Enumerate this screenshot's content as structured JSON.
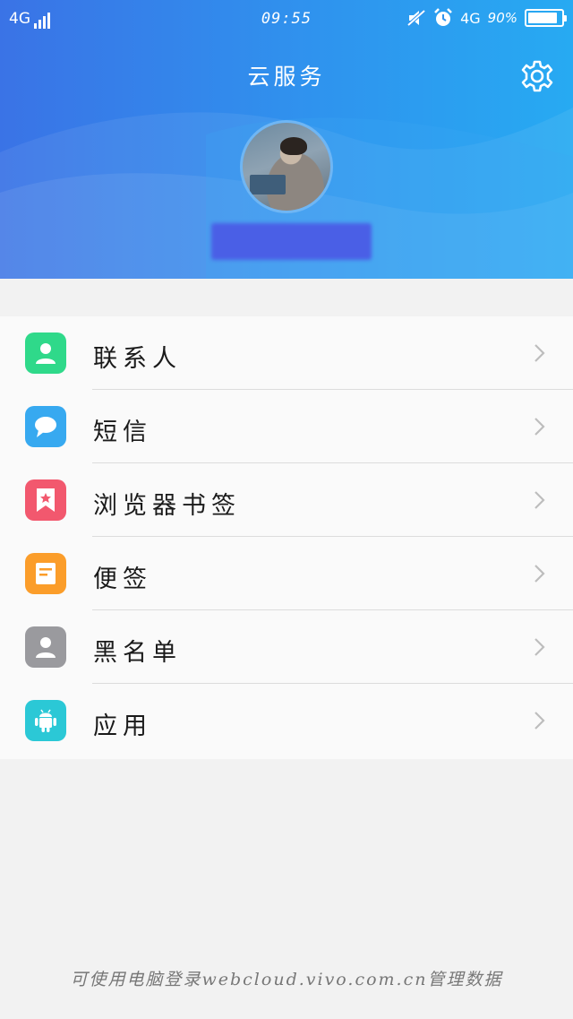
{
  "status_bar": {
    "network_left": "4G",
    "time": "09:55",
    "network_right": "4G",
    "battery_percent": "90%",
    "battery_level": 0.9,
    "icons": [
      "signal-bars-icon",
      "mute-icon",
      "alarm-icon",
      "battery-icon"
    ]
  },
  "header": {
    "title": "云服务",
    "settings_icon": "gear-icon",
    "avatar": "user-avatar-photo",
    "username_redacted": true
  },
  "menu": {
    "items": [
      {
        "label": "联系人",
        "icon": "contacts-icon",
        "color": "#2fd98a"
      },
      {
        "label": "短信",
        "icon": "message-bubble-icon",
        "color": "#37a9f0"
      },
      {
        "label": "浏览器书签",
        "icon": "bookmark-star-icon",
        "color": "#f2586e"
      },
      {
        "label": "便签",
        "icon": "note-icon",
        "color": "#fb9d2a"
      },
      {
        "label": "黑名单",
        "icon": "blocked-contact-icon",
        "color": "#9a9a9e"
      },
      {
        "label": "应用",
        "icon": "android-icon",
        "color": "#2bc8d6"
      }
    ],
    "chevron_icon": "chevron-right-icon"
  },
  "footer": {
    "text": "可使用电脑登录webcloud.vivo.com.cn管理数据"
  },
  "colors": {
    "header_gradient_start": "#3a73e6",
    "header_gradient_end": "#27aaf2",
    "page_background": "#f2f2f2",
    "list_background": "#fafafa"
  }
}
